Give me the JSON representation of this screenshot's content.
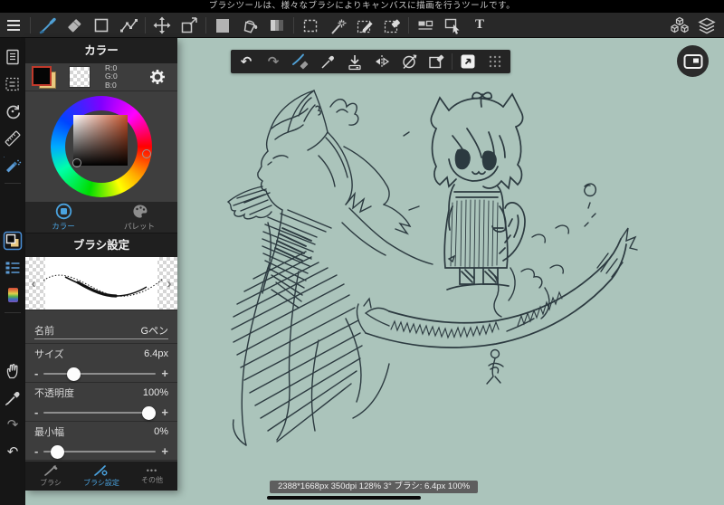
{
  "tooltip_bar": {
    "text": "ブラシツールは、様々なブラシによりキャンバスに描画を行うツールです。"
  },
  "toolbar": {
    "text_tool_label": "T"
  },
  "icons": {
    "undo": "↶",
    "redo": "↷",
    "prev": "‹",
    "next": "›",
    "more_dots": "•••"
  },
  "color_panel": {
    "title": "カラー",
    "rgb": {
      "r": "R:0",
      "g": "G:0",
      "b": "B:0"
    },
    "tabs": [
      {
        "label": "カラー",
        "active": true
      },
      {
        "label": "パレット",
        "active": false
      }
    ]
  },
  "brush_panel": {
    "title": "ブラシ設定",
    "name_label": "名前",
    "name_value": "Gペン",
    "size_label": "サイズ",
    "size_value": "6.4px",
    "opacity_label": "不透明度",
    "opacity_value": "100%",
    "minwidth_label": "最小幅",
    "minwidth_value": "0%",
    "minus": "-",
    "plus": "+",
    "tabs": [
      {
        "label": "ブラシ",
        "active": false
      },
      {
        "label": "ブラシ設定",
        "active": true
      },
      {
        "label": "その他",
        "active": false
      }
    ]
  },
  "statusbar": {
    "text": "2388*1668px 350dpi 128% 3° ブラシ: 6.4px 100%"
  },
  "colors": {
    "canvas": "#abc4bb",
    "accent_blue": "#4f9fd4",
    "ink": "#2c3a40",
    "fg_swatch": "#000000",
    "bg_swatch": "#e9c87f",
    "swatch_border": "#c0392b"
  }
}
